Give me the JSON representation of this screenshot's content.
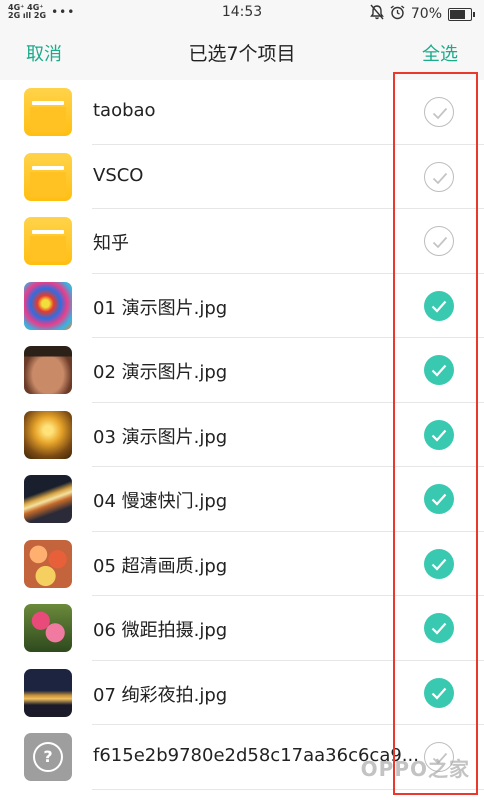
{
  "status_bar": {
    "network_top": "4G⁺ 4G⁺",
    "network_bottom": "2G ıll 2G",
    "dots": "•••",
    "time": "14:53",
    "battery": "70%",
    "battery_level": 0.7
  },
  "header": {
    "cancel_label": "取消",
    "title": "已选7个项目",
    "select_all_label": "全选",
    "accent_color": "#1aab8a"
  },
  "items": [
    {
      "name": "taobao",
      "thumb": "folder",
      "checked": false
    },
    {
      "name": "VSCO",
      "thumb": "folder",
      "checked": false
    },
    {
      "name": "知乎",
      "thumb": "folder",
      "checked": false
    },
    {
      "name": "01 演示图片.jpg",
      "thumb": "photo-colorful-ball",
      "checked": true
    },
    {
      "name": "02 演示图片.jpg",
      "thumb": "photo-face",
      "checked": true
    },
    {
      "name": "03 演示图片.jpg",
      "thumb": "photo-trees",
      "checked": true
    },
    {
      "name": "04 慢速快门.jpg",
      "thumb": "photo-night-street",
      "checked": true
    },
    {
      "name": "05 超清画质.jpg",
      "thumb": "photo-candy",
      "checked": true
    },
    {
      "name": "06 微距拍摄.jpg",
      "thumb": "photo-flowers",
      "checked": true
    },
    {
      "name": "07 绚彩夜拍.jpg",
      "thumb": "photo-night-city",
      "checked": true
    },
    {
      "name": "f615e2b9780e2d58c17aa36c6ca9...",
      "thumb": "unknown-file",
      "checked": false
    }
  ],
  "check_color": "#38c9b0",
  "watermark": "OPPO之家"
}
